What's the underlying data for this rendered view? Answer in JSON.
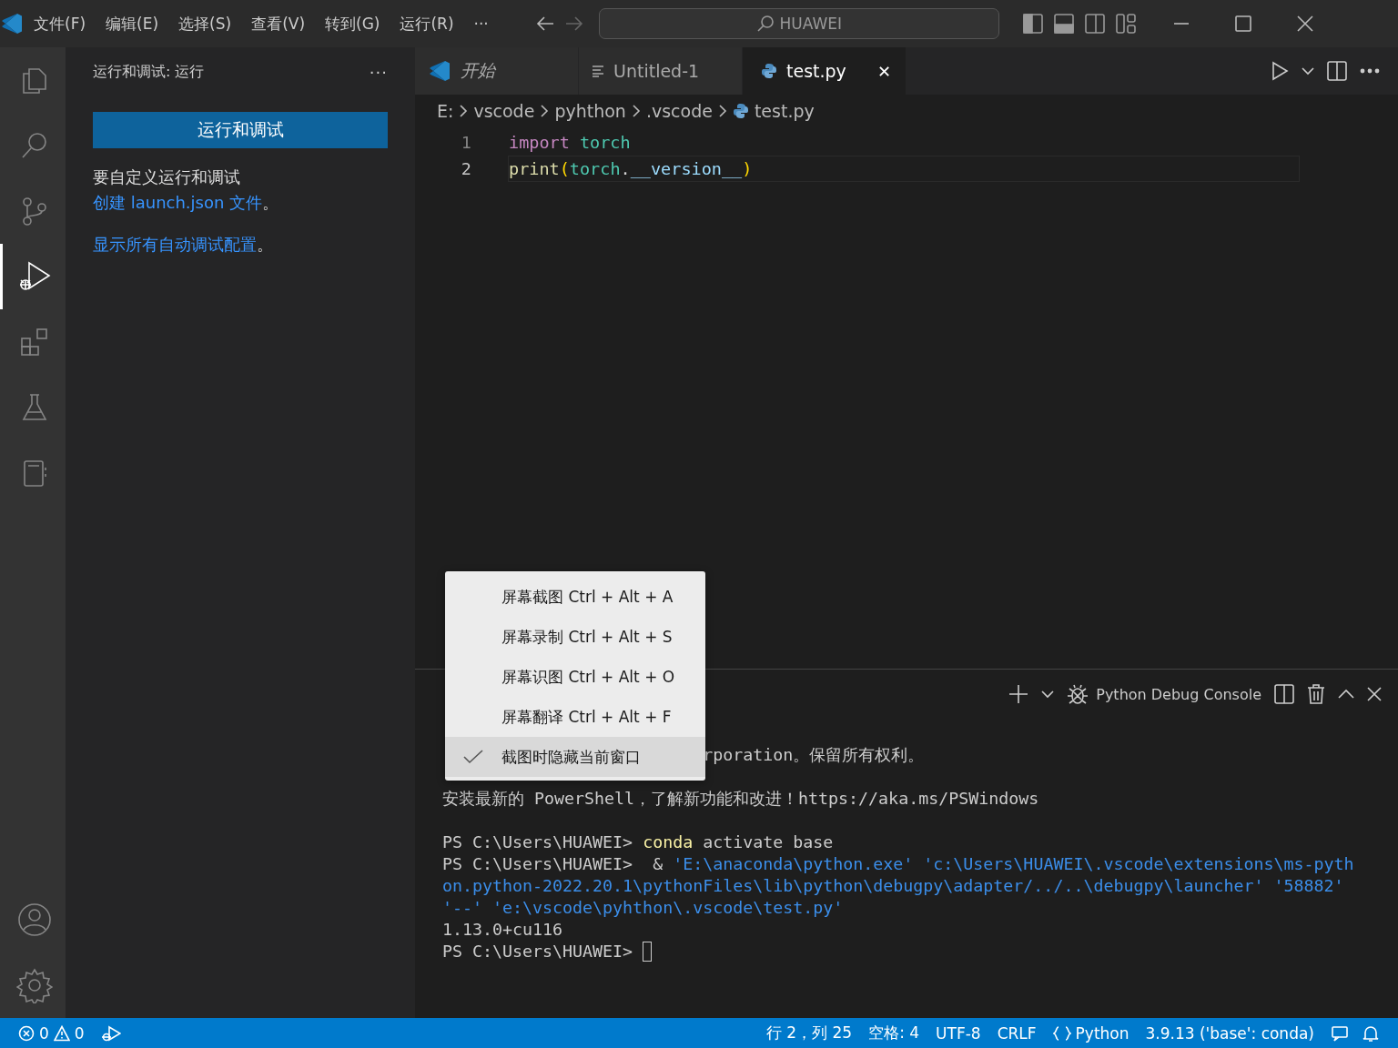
{
  "title_bar": {
    "menus": [
      "文件(F)",
      "编辑(E)",
      "选择(S)",
      "查看(V)",
      "转到(G)",
      "运行(R)"
    ],
    "more": "···",
    "search": "HUAWEI"
  },
  "activity_bar": {
    "items": [
      {
        "kind": "files",
        "selected": false
      },
      {
        "kind": "search",
        "selected": false
      },
      {
        "kind": "source-control",
        "selected": false
      },
      {
        "kind": "run-debug",
        "selected": true
      },
      {
        "kind": "extensions",
        "selected": false
      },
      {
        "kind": "testing",
        "selected": false
      },
      {
        "kind": "notebook",
        "selected": false
      }
    ],
    "bottom": [
      {
        "kind": "account"
      },
      {
        "kind": "settings"
      }
    ]
  },
  "sidebar": {
    "title": "运行和调试: 运行",
    "more": "···",
    "button": "运行和调试",
    "paragraphs": [
      {
        "text": "要自定义运行和调试",
        "link": "创建 launch.json 文件",
        "end": "。"
      },
      {
        "link": "显示所有自动调试配置",
        "end": "。"
      }
    ]
  },
  "tabs": [
    {
      "kind": "welcome",
      "label": "开始",
      "selected": false
    },
    {
      "kind": "text",
      "label": "Untitled-1",
      "selected": false
    },
    {
      "kind": "python",
      "label": "test.py",
      "selected": true,
      "close": "✕"
    }
  ],
  "breadcrumbs": [
    {
      "kind": "folder",
      "label": "E:"
    },
    {
      "kind": "folder",
      "label": "vscode"
    },
    {
      "kind": "folder",
      "label": "pyhthon"
    },
    {
      "kind": "folder",
      "label": ".vscode"
    },
    {
      "kind": "python",
      "label": "test.py"
    }
  ],
  "code": [
    {
      "number": "1",
      "current": false,
      "tokens": [
        {
          "kind": "keyword",
          "text": "import"
        },
        {
          "kind": "module",
          "text": "torch"
        }
      ]
    },
    {
      "number": "2",
      "current": true,
      "tokens": [
        {
          "kind": "function",
          "text": "print"
        },
        {
          "kind": "bracket",
          "text": "("
        },
        {
          "kind": "module",
          "text": "torch"
        },
        {
          "kind": "plain",
          "text": "."
        },
        {
          "kind": "variable",
          "text": "__version__"
        },
        {
          "kind": "bracket",
          "text": ")"
        }
      ]
    }
  ],
  "panel": {
    "terminal_name": "Python Debug Console",
    "lines": [
      {
        "segments": [
          {
            "kind": "partial",
            "text": "rporation。保留所有权利。"
          }
        ]
      },
      {
        "blank_before": true,
        "segments": [
          {
            "kind": "plain",
            "text": "安装最新的 PowerShell，了解新功能和改进！https://aka.ms/PSWindows"
          }
        ]
      },
      {
        "blank_before": true,
        "segments": [
          {
            "kind": "plain",
            "text": "PS C:\\Users\\HUAWEI> "
          },
          {
            "kind": "command",
            "text": "conda"
          },
          {
            "kind": "plain",
            "text": " activate base"
          }
        ]
      },
      {
        "segments": [
          {
            "kind": "plain",
            "text": "PS C:\\Users\\HUAWEI>  & "
          },
          {
            "kind": "string",
            "text": "'E:\\anaconda\\python.exe' 'c:\\Users\\HUAWEI\\.vscode\\extensions\\ms-python.python-2022.20.1\\pythonFiles\\lib\\python\\debugpy\\adapter/../..\\debugpy\\launcher' '58882' '--' 'e:\\vscode\\pyhthon\\.vscode\\test.py'"
          }
        ]
      },
      {
        "segments": [
          {
            "kind": "plain",
            "text": "1.13.0+cu116"
          }
        ]
      },
      {
        "segments": [
          {
            "kind": "plain",
            "text": "PS C:\\Users\\HUAWEI> "
          }
        ],
        "cursor": true
      }
    ]
  },
  "context_menu": [
    {
      "label": "屏幕截图 Ctrl + Alt + A",
      "checked": false,
      "selected": false
    },
    {
      "label": "屏幕录制 Ctrl + Alt + S",
      "checked": false,
      "selected": false
    },
    {
      "label": "屏幕识图 Ctrl + Alt + O",
      "checked": false,
      "selected": false
    },
    {
      "label": "屏幕翻译 Ctrl + Alt + F",
      "checked": false,
      "selected": false
    },
    {
      "label": "截图时隐藏当前窗口",
      "checked": true,
      "selected": true
    }
  ],
  "status_bar": {
    "errors": "0",
    "warnings": "0",
    "right": [
      "行 2，列 25",
      "空格: 4",
      "UTF-8",
      "CRLF",
      "Python",
      "3.9.13 ('base': conda)"
    ]
  }
}
